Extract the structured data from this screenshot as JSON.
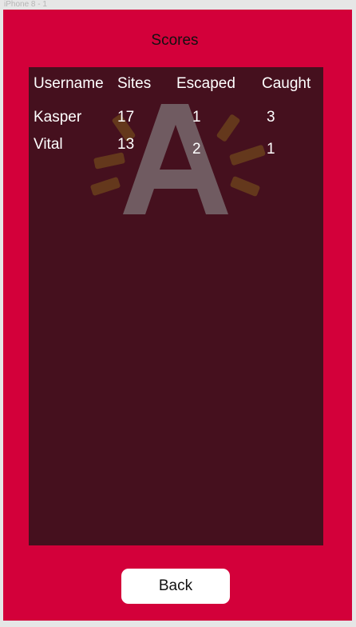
{
  "artboard": {
    "label": "iPhone 8 - 1"
  },
  "colors": {
    "background": "#d3003a",
    "panel": "#45101e",
    "text": "#ffffff",
    "button": "#ffffff"
  },
  "screen": {
    "title": "Scores",
    "table": {
      "headers": [
        "Username",
        "Sites",
        "Escaped",
        "Caught"
      ],
      "rows": [
        {
          "username": "Kasper",
          "sites": "17",
          "escaped": "1",
          "caught": "3"
        },
        {
          "username": "Vital",
          "sites": "13",
          "escaped": "2",
          "caught": "1"
        }
      ]
    },
    "back_button": {
      "label": "Back"
    },
    "watermark_icon": "letter-a-loading-icon"
  }
}
